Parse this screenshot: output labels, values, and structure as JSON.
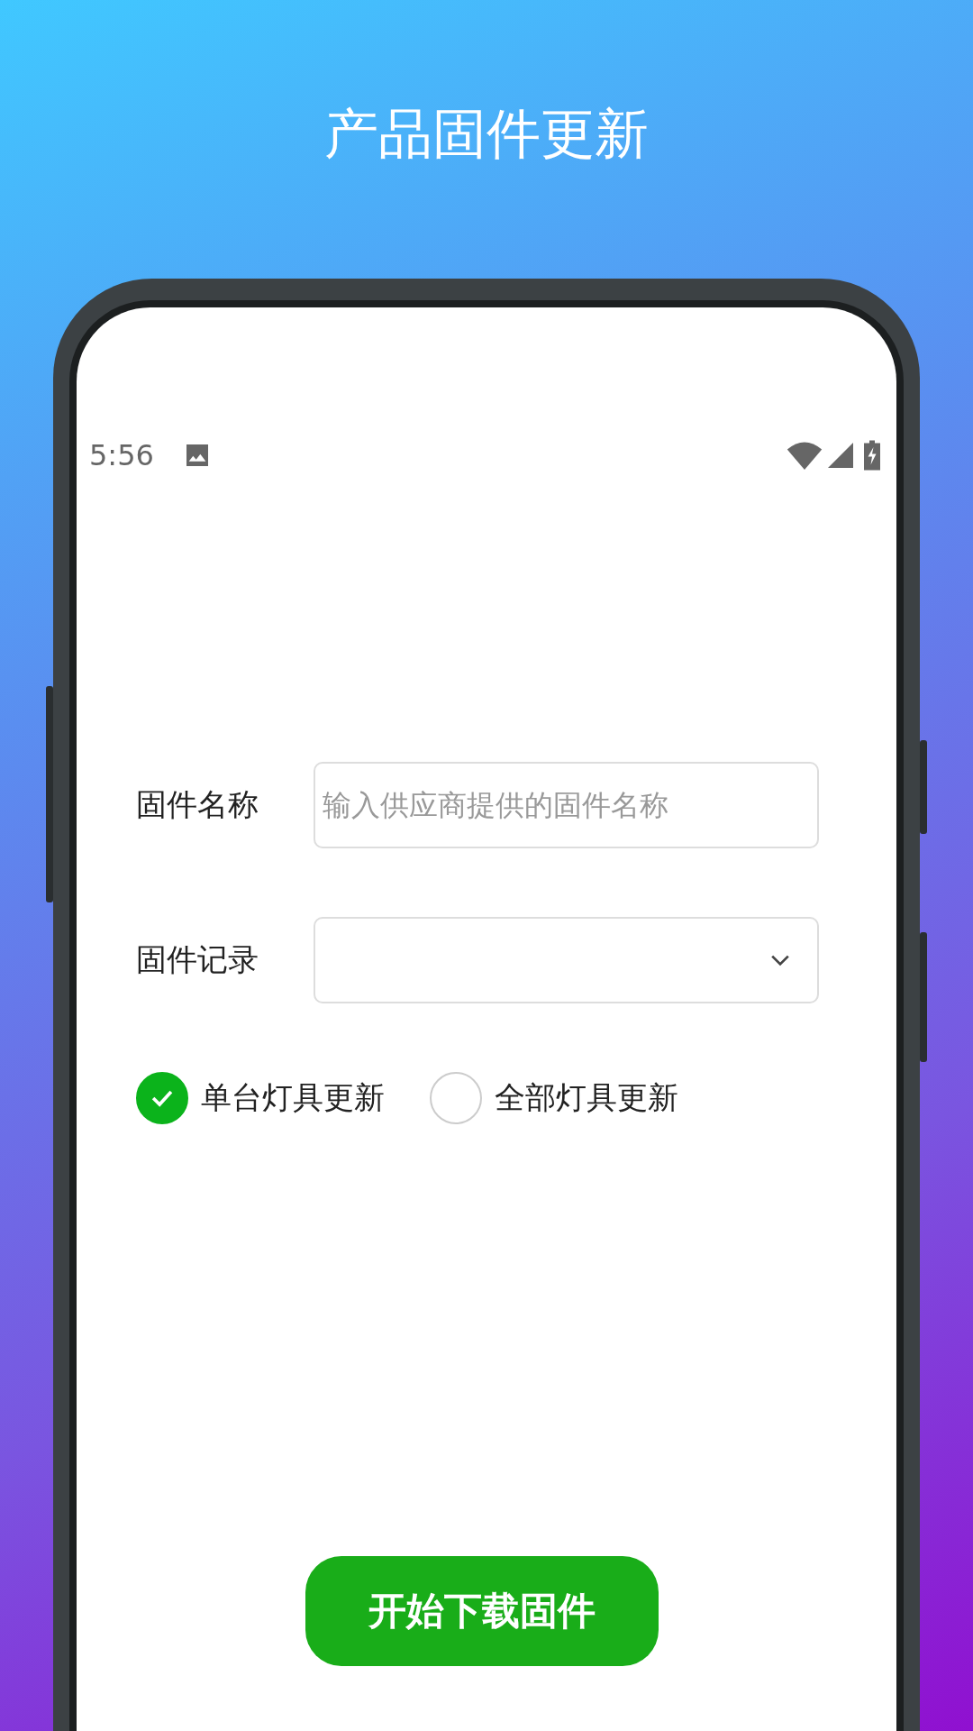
{
  "title": "产品固件更新",
  "status_bar": {
    "time": "5:56"
  },
  "form": {
    "fields": [
      {
        "label": "固件名称",
        "kind": "text",
        "placeholder": "输入供应商提供的固件名称"
      },
      {
        "label": "固件记录",
        "kind": "select"
      }
    ],
    "options": [
      {
        "label": "单台灯具更新",
        "selected": true
      },
      {
        "label": "全部灯具更新",
        "selected": false
      }
    ]
  },
  "button": "开始下载固件"
}
